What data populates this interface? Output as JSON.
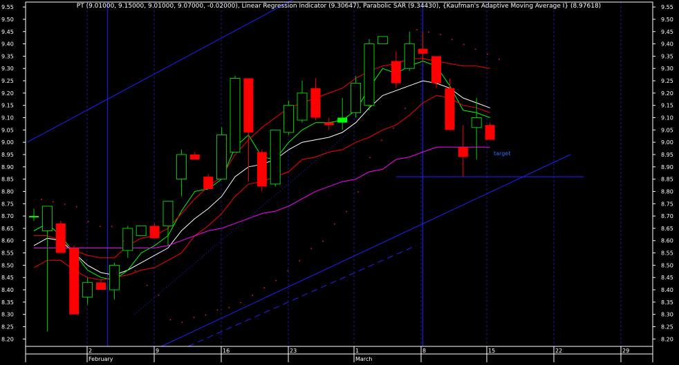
{
  "chart_data": {
    "type": "candlestick",
    "title": "PT (9.01000, 9.15000, 9.01000, 9.07000, -0.02000), Linear Regression Indicator (9.30647), Parabolic SAR (9.34430), {Kaufman's Adaptive Moving Average I} (8.97618)",
    "ylim": [
      8.17,
      9.57
    ],
    "y_ticks": [
      8.2,
      8.25,
      8.3,
      8.35,
      8.4,
      8.45,
      8.5,
      8.55,
      8.6,
      8.65,
      8.7,
      8.75,
      8.8,
      8.85,
      8.9,
      8.95,
      9.0,
      9.05,
      9.1,
      9.15,
      9.2,
      9.25,
      9.3,
      9.35,
      9.4,
      9.45,
      9.5,
      9.55
    ],
    "x_ticks": [
      "2",
      "9",
      "16",
      "23",
      "1",
      "8",
      "15",
      "22",
      "29"
    ],
    "month_labels": [
      "February",
      "March"
    ],
    "annotation": "target",
    "grid": true,
    "colors": {
      "background": "#000000",
      "frame": "#ffffff",
      "grid": "#1a1a9a",
      "up_candle": "#00d000",
      "down_candle": "#ff0000",
      "doji_up_fill": "#00ff00",
      "line_white": "#ffffff",
      "line_green": "#00ff00",
      "line_red": "#ff0000",
      "line_magenta": "#ff00ff",
      "trend_lines": "#2020ff",
      "sar_dots": "#ff2020",
      "text": "#ffffff",
      "annotation_text": "#3070ff"
    },
    "candles": [
      {
        "o": 8.7,
        "h": 8.73,
        "l": 8.68,
        "c": 8.7
      },
      {
        "o": 8.64,
        "h": 8.74,
        "l": 8.23,
        "c": 8.74
      },
      {
        "o": 8.67,
        "h": 8.68,
        "l": 8.55,
        "c": 8.55
      },
      {
        "o": 8.57,
        "h": 8.58,
        "l": 8.3,
        "c": 8.3
      },
      {
        "o": 8.37,
        "h": 8.45,
        "l": 8.34,
        "c": 8.43
      },
      {
        "o": 8.43,
        "h": 8.44,
        "l": 8.4,
        "c": 8.4
      },
      {
        "o": 8.4,
        "h": 8.51,
        "l": 8.36,
        "c": 8.5
      },
      {
        "o": 8.56,
        "h": 8.66,
        "l": 8.53,
        "c": 8.65
      },
      {
        "o": 8.62,
        "h": 8.66,
        "l": 8.62,
        "c": 8.66
      },
      {
        "o": 8.66,
        "h": 8.67,
        "l": 8.61,
        "c": 8.61
      },
      {
        "o": 8.66,
        "h": 8.75,
        "l": 8.58,
        "c": 8.76
      },
      {
        "o": 8.85,
        "h": 8.97,
        "l": 8.78,
        "c": 8.95
      },
      {
        "o": 8.95,
        "h": 8.96,
        "l": 8.93,
        "c": 8.93
      },
      {
        "o": 8.86,
        "h": 8.87,
        "l": 8.81,
        "c": 8.81
      },
      {
        "o": 8.85,
        "h": 9.06,
        "l": 8.85,
        "c": 9.03
      },
      {
        "o": 8.96,
        "h": 9.27,
        "l": 8.96,
        "c": 9.26
      },
      {
        "o": 9.26,
        "h": 9.26,
        "l": 8.84,
        "c": 9.04
      },
      {
        "o": 8.96,
        "h": 8.97,
        "l": 8.8,
        "c": 8.82
      },
      {
        "o": 8.83,
        "h": 9.05,
        "l": 8.82,
        "c": 9.05
      },
      {
        "o": 9.04,
        "h": 9.17,
        "l": 9.03,
        "c": 9.15
      },
      {
        "o": 9.09,
        "h": 9.25,
        "l": 9.08,
        "c": 9.2
      },
      {
        "o": 9.22,
        "h": 9.26,
        "l": 9.09,
        "c": 9.1
      },
      {
        "o": 9.08,
        "h": 9.1,
        "l": 9.05,
        "c": 9.07
      },
      {
        "o": 9.08,
        "h": 9.18,
        "l": 9.05,
        "c": 9.1
      },
      {
        "o": 9.12,
        "h": 9.27,
        "l": 9.1,
        "c": 9.24
      },
      {
        "o": 9.15,
        "h": 9.42,
        "l": 9.13,
        "c": 9.4
      },
      {
        "o": 9.4,
        "h": 9.43,
        "l": 9.4,
        "c": 9.43
      },
      {
        "o": 9.33,
        "h": 9.37,
        "l": 9.22,
        "c": 9.24
      },
      {
        "o": 9.3,
        "h": 9.45,
        "l": 9.29,
        "c": 9.4
      },
      {
        "o": 9.38,
        "h": 9.45,
        "l": 9.33,
        "c": 9.36
      },
      {
        "o": 9.35,
        "h": 9.35,
        "l": 9.22,
        "c": 9.24
      },
      {
        "o": 9.22,
        "h": 9.26,
        "l": 9.05,
        "c": 9.05
      },
      {
        "o": 8.98,
        "h": 9.07,
        "l": 8.86,
        "c": 8.94
      },
      {
        "o": 9.06,
        "h": 9.18,
        "l": 8.93,
        "c": 9.1
      },
      {
        "o": 9.07,
        "h": 9.08,
        "l": 9.01,
        "c": 9.01
      }
    ],
    "series": [
      {
        "key": "white_ma",
        "values": [
          8.58,
          8.61,
          8.6,
          8.55,
          8.5,
          8.47,
          8.46,
          8.48,
          8.51,
          8.54,
          8.57,
          8.64,
          8.69,
          8.73,
          8.78,
          8.86,
          8.9,
          8.91,
          8.93,
          8.97,
          9.0,
          9.01,
          9.02,
          9.04,
          9.08,
          9.14,
          9.19,
          9.21,
          9.23,
          9.25,
          9.24,
          9.22,
          9.18,
          9.16,
          9.14
        ]
      },
      {
        "key": "green_ma",
        "values": [
          8.64,
          8.67,
          8.62,
          8.55,
          8.48,
          8.45,
          8.44,
          8.48,
          8.55,
          8.58,
          8.62,
          8.72,
          8.8,
          8.81,
          8.85,
          8.98,
          9.03,
          8.94,
          8.93,
          9.0,
          9.05,
          9.08,
          9.08,
          9.09,
          9.13,
          9.22,
          9.3,
          9.28,
          9.31,
          9.33,
          9.31,
          9.23,
          9.13,
          9.12,
          9.1
        ]
      },
      {
        "key": "red_upper",
        "values": [
          8.62,
          8.62,
          8.6,
          8.56,
          8.54,
          8.53,
          8.53,
          8.58,
          8.61,
          8.62,
          8.65,
          8.71,
          8.77,
          8.82,
          8.86,
          8.95,
          9.01,
          9.06,
          9.1,
          9.14,
          9.16,
          9.18,
          9.2,
          9.22,
          9.26,
          9.29,
          9.31,
          9.32,
          9.34,
          9.34,
          9.33,
          9.32,
          9.31,
          9.31,
          9.3
        ]
      },
      {
        "key": "red_lower",
        "values": [
          8.49,
          8.52,
          8.52,
          8.48,
          8.45,
          8.44,
          8.45,
          8.46,
          8.48,
          8.49,
          8.52,
          8.55,
          8.62,
          8.66,
          8.71,
          8.78,
          8.83,
          8.84,
          8.86,
          8.88,
          8.93,
          8.94,
          8.96,
          8.97,
          9.0,
          9.02,
          9.05,
          9.07,
          9.11,
          9.16,
          9.19,
          9.18,
          9.15,
          9.14,
          9.12
        ]
      },
      {
        "key": "magenta_kama",
        "values": [
          8.57,
          8.57,
          8.57,
          8.57,
          8.57,
          8.57,
          8.57,
          8.57,
          8.57,
          8.57,
          8.58,
          8.6,
          8.62,
          8.64,
          8.65,
          8.67,
          8.69,
          8.71,
          8.72,
          8.74,
          8.77,
          8.8,
          8.82,
          8.84,
          8.85,
          8.88,
          8.89,
          8.93,
          8.94,
          8.96,
          8.98,
          8.98,
          8.98,
          8.98,
          8.98
        ]
      }
    ],
    "sar": [
      8.77,
      8.76,
      8.75,
      8.74,
      8.68,
      8.66,
      8.66,
      8.6,
      8.48,
      8.42,
      8.38,
      8.28,
      8.27,
      8.29,
      8.3,
      8.32,
      8.33,
      8.35,
      8.38,
      8.41,
      8.44,
      8.48,
      8.52,
      8.57,
      8.6,
      8.67,
      8.72,
      8.8,
      8.94,
      9.01,
      9.06,
      9.14,
      9.46,
      9.45,
      9.44,
      9.42,
      9.4,
      9.38,
      9.36,
      9.34
    ],
    "trend_lines": [
      {
        "p1": [
          -0.5,
          9.0
        ],
        "p2": [
          20.0,
          9.6
        ]
      },
      {
        "p1": [
          9.5,
          8.17
        ],
        "p2": [
          40.0,
          8.95
        ]
      },
      {
        "p1": [
          11.5,
          8.17
        ],
        "p2": [
          28.5,
          8.58
        ],
        "dashed": true
      },
      {
        "p1": [
          27.0,
          8.86
        ],
        "p2": [
          41.0,
          8.86
        ]
      }
    ],
    "dotted_line": {
      "p1": [
        7.5,
        8.3
      ],
      "p2": [
        23.5,
        9.04
      ]
    },
    "vertical_lines": [
      5.5,
      29.0
    ]
  }
}
